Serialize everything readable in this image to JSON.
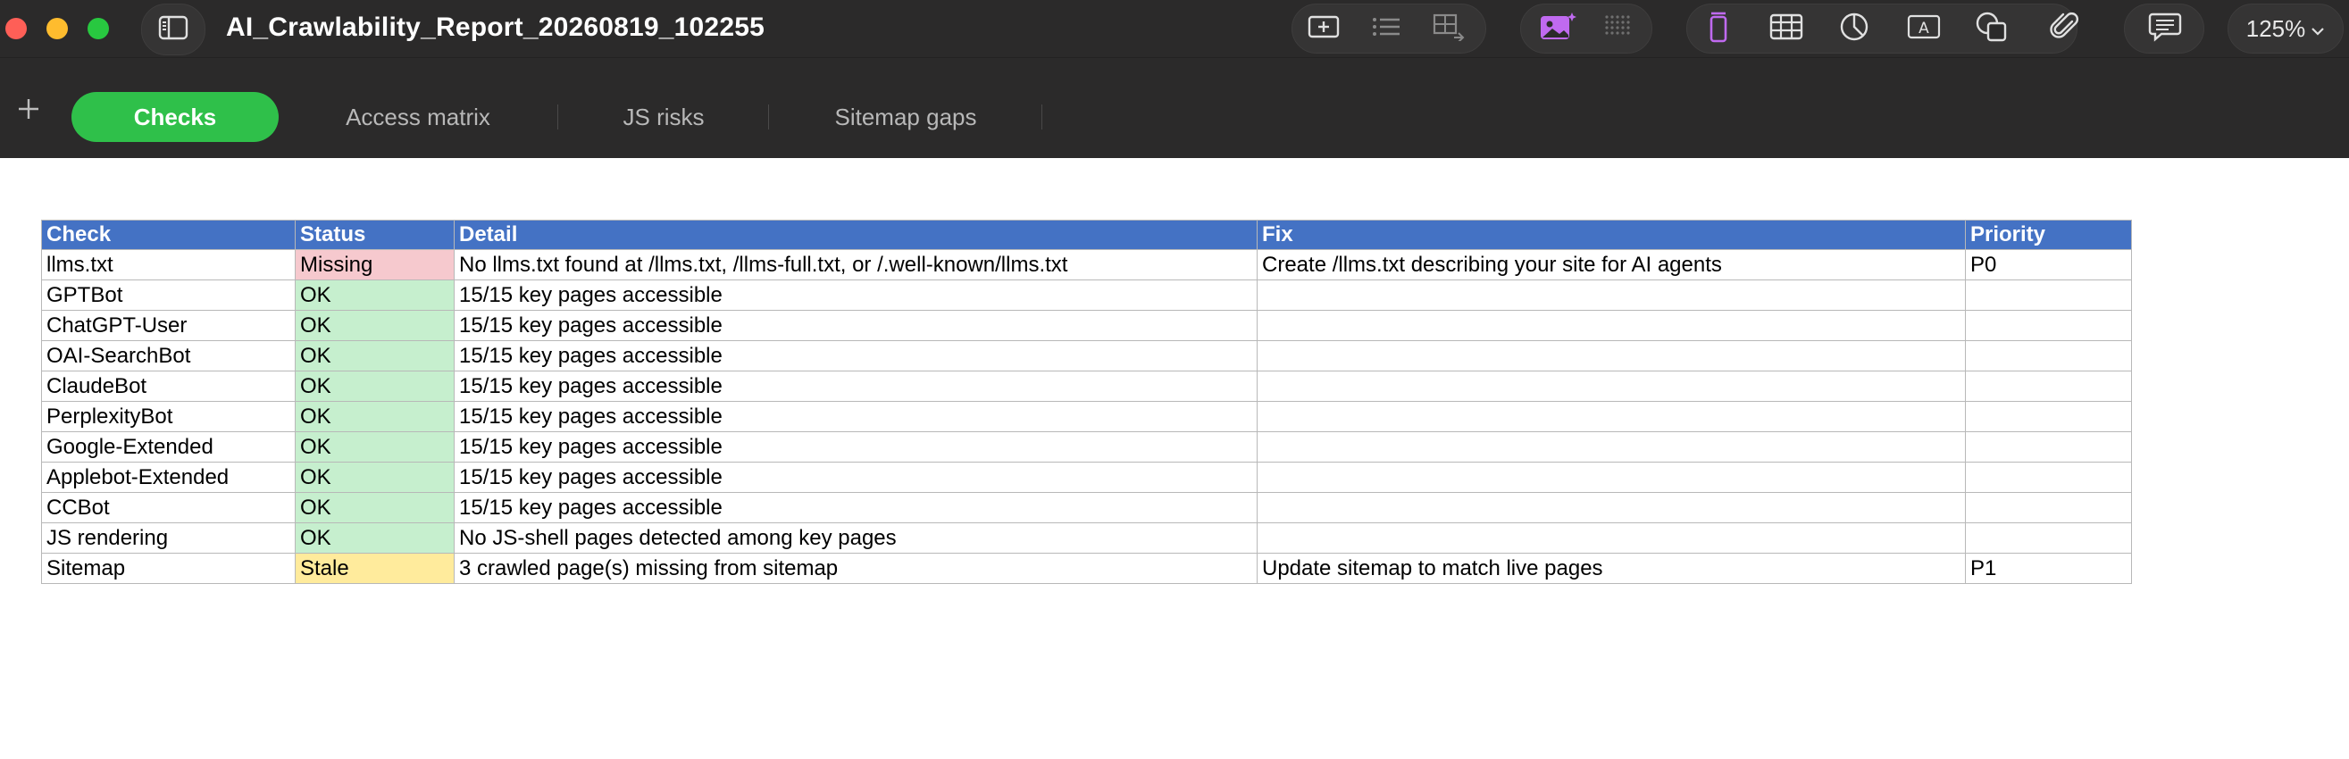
{
  "window": {
    "title": "AI_Crawlability_Report_20260819_102255",
    "zoom": "125%"
  },
  "toolbar": {
    "icons": [
      "sidebar-icon",
      "insert-icon",
      "list-icon",
      "table-adjust-icon",
      "media-icon",
      "grid-icon",
      "text-icon",
      "table-icon",
      "chart-icon",
      "textbox-icon",
      "shape-icon",
      "attachment-icon",
      "comment-icon",
      "chevron-down-icon"
    ],
    "accent_purple": "#c06af0"
  },
  "sheets": {
    "tabs": [
      {
        "label": "Checks",
        "active": true
      },
      {
        "label": "Access matrix",
        "active": false
      },
      {
        "label": "JS risks",
        "active": false
      },
      {
        "label": "Sitemap gaps",
        "active": false
      }
    ],
    "active_color": "#2fc04a"
  },
  "table": {
    "header_color": "#4472c4",
    "columns": [
      "Check",
      "Status",
      "Detail",
      "Fix",
      "Priority"
    ],
    "rows": [
      {
        "check": "llms.txt",
        "status": "Missing",
        "status_type": "missing",
        "detail": "No llms.txt found at /llms.txt, /llms-full.txt, or /.well-known/llms.txt",
        "fix": "Create /llms.txt describing your site for AI agents",
        "priority": "P0"
      },
      {
        "check": "GPTBot",
        "status": "OK",
        "status_type": "ok",
        "detail": "15/15 key pages accessible",
        "fix": "",
        "priority": ""
      },
      {
        "check": "ChatGPT-User",
        "status": "OK",
        "status_type": "ok",
        "detail": "15/15 key pages accessible",
        "fix": "",
        "priority": ""
      },
      {
        "check": "OAI-SearchBot",
        "status": "OK",
        "status_type": "ok",
        "detail": "15/15 key pages accessible",
        "fix": "",
        "priority": ""
      },
      {
        "check": "ClaudeBot",
        "status": "OK",
        "status_type": "ok",
        "detail": "15/15 key pages accessible",
        "fix": "",
        "priority": ""
      },
      {
        "check": "PerplexityBot",
        "status": "OK",
        "status_type": "ok",
        "detail": "15/15 key pages accessible",
        "fix": "",
        "priority": ""
      },
      {
        "check": "Google-Extended",
        "status": "OK",
        "status_type": "ok",
        "detail": "15/15 key pages accessible",
        "fix": "",
        "priority": ""
      },
      {
        "check": "Applebot-Extended",
        "status": "OK",
        "status_type": "ok",
        "detail": "15/15 key pages accessible",
        "fix": "",
        "priority": ""
      },
      {
        "check": "CCBot",
        "status": "OK",
        "status_type": "ok",
        "detail": "15/15 key pages accessible",
        "fix": "",
        "priority": ""
      },
      {
        "check": "JS rendering",
        "status": "OK",
        "status_type": "ok",
        "detail": "No JS-shell pages detected among key pages",
        "fix": "",
        "priority": ""
      },
      {
        "check": "Sitemap",
        "status": "Stale",
        "status_type": "stale",
        "detail": "3 crawled page(s) missing from sitemap",
        "fix": "Update sitemap to match live pages",
        "priority": "P1"
      }
    ]
  }
}
